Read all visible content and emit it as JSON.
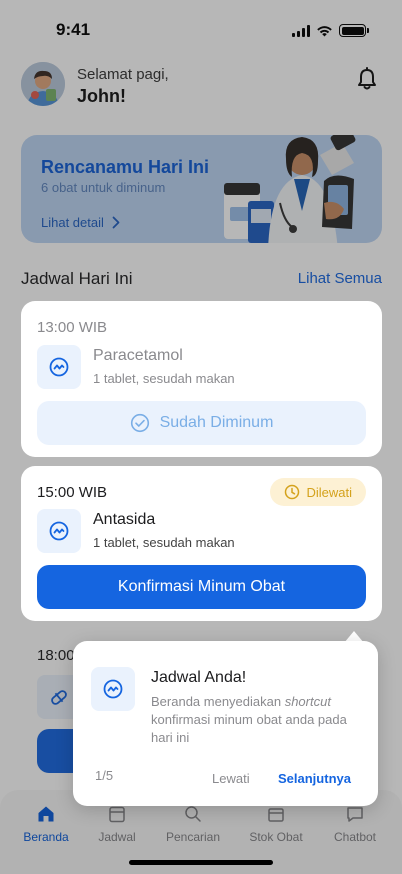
{
  "status": {
    "time": "9:41"
  },
  "header": {
    "greeting": "Selamat pagi,",
    "name": "John!"
  },
  "plan": {
    "title": "Rencanamu Hari Ini",
    "subtitle": "6 obat untuk diminum",
    "link_label": "Lihat detail"
  },
  "schedule": {
    "title": "Jadwal Hari Ini",
    "see_all": "Lihat Semua",
    "cards": [
      {
        "time": "13:00 WIB",
        "name": "Paracetamol",
        "desc": "1 tablet, sesudah makan",
        "button": "Sudah Diminum"
      },
      {
        "time": "15:00 WIB",
        "badge": "Dilewati",
        "name": "Antasida",
        "desc": "1  tablet, sesudah makan",
        "button": "Konfirmasi Minum Obat"
      },
      {
        "time": "18:00"
      }
    ]
  },
  "popup": {
    "title": "Jadwal Anda!",
    "body_before": "Beranda menyediakan ",
    "body_emphasis": "shortcut",
    "body_after": " konfirmasi minum obat anda pada hari ini",
    "step": "1/5",
    "skip": "Lewati",
    "next": "Selanjutnya"
  },
  "nav": {
    "items": [
      {
        "label": "Beranda",
        "icon": "home-icon"
      },
      {
        "label": "Jadwal",
        "icon": "calendar-icon"
      },
      {
        "label": "Pencarian",
        "icon": "search-icon"
      },
      {
        "label": "Stok Obat",
        "icon": "box-icon"
      },
      {
        "label": "Chatbot",
        "icon": "chat-icon"
      }
    ]
  },
  "colors": {
    "primary": "#1565e0",
    "banner_bg": "#bcd4f3",
    "missed_badge": "#d4a21c",
    "overlay": "rgba(30,30,30,0.32)"
  }
}
